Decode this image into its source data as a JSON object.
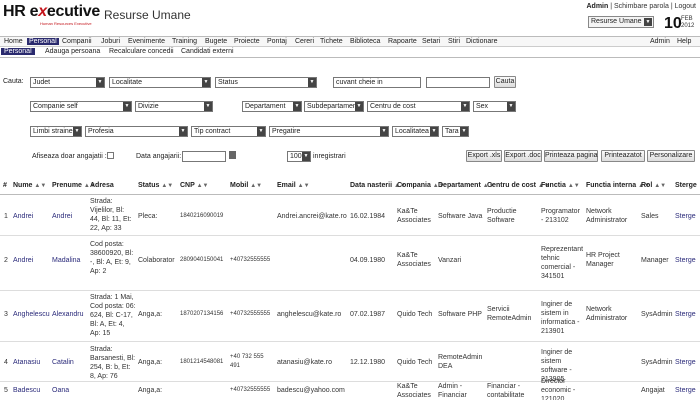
{
  "header": {
    "logo_main": "HR e",
    "logo_x": "x",
    "logo_rest": "ecutive",
    "logo_sub": "Human Resources Executive",
    "app_title": "Resurse Umane",
    "user": "Admin",
    "link_password": "Schimbare parola",
    "link_logout": "Logout",
    "module_select": "Resurse Umane",
    "date_day": "10",
    "date_month": "FEB",
    "date_year": "2012"
  },
  "menu": {
    "items": [
      "Home",
      "Personal",
      "Companii",
      "Joburi",
      "Evenimente",
      "Training",
      "Bugete",
      "Proiecte",
      "Pontaj",
      "Cereri",
      "Tichete",
      "Biblioteca",
      "Rapoarte",
      "Setari",
      "Stiri",
      "Dictionare"
    ],
    "admin": "Admin",
    "help": "Help"
  },
  "submenu": {
    "items": [
      "Personal",
      "Adauga persoana",
      "Recalculare concedii",
      "Candidati externi"
    ]
  },
  "filters": {
    "cauta_label": "Cauta:",
    "judet": "Judet",
    "localitate": "Localitate",
    "status": "Status",
    "keyword_placeholder": "cuvant cheie in",
    "cauta_button": "Cauta",
    "companie": "Companie self",
    "divizie": "Divizie",
    "departament": "Departament",
    "subdepartament": "Subdepartament",
    "centru_cost": "Centru de cost",
    "sex": "Sex",
    "limbi_straine": "Limbi straine",
    "profesia": "Profesia",
    "tip_contract": "Tip contract",
    "pregatire": "Pregatire",
    "localitatea": "Localitatea",
    "tara": "Tara",
    "only_employees_label": "Afiseaza doar angajatii :",
    "hire_date_label": "Data angajarii:",
    "per_page": "100",
    "per_page_suffix": "inregistrari",
    "btn_export_xls": "Export .xls",
    "btn_export_doc": "Export .doc",
    "btn_print_page": "Printeaza pagina",
    "btn_print_all": "Printeazatot",
    "btn_personalize": "Personalizare"
  },
  "table": {
    "columns": [
      "#",
      "Nume",
      "Prenume",
      "Adresa",
      "Status",
      "CNP",
      "Mobil",
      "Email",
      "Data nasterii",
      "Compania",
      "Departament",
      "Centru de cost",
      "Functia",
      "Functia interna",
      "Rol",
      "Sterge"
    ],
    "rows": [
      {
        "num": "1",
        "nume": "Andrei",
        "prenume": "Andrei",
        "adresa": "Strada: Vijelilor, Bl: 44, Bl: 11, Et: 22, Ap: 33",
        "status": "Pleca:",
        "cnp": "1840216090019",
        "mobil": "",
        "email": "Andrei.ancrei@kate.ro",
        "data": "16.02.1984",
        "compania": "Ka&Te Associates",
        "departament": "Software Java",
        "centru": "Productie Software",
        "functia": "Programator - 213102",
        "functia_interna": "Network Administrator",
        "rol": "Sales",
        "sterge": "Sterge"
      },
      {
        "num": "2",
        "nume": "Andrei",
        "prenume": "Madalina",
        "adresa": "Cod posta: 38600920, Bl: -, Bl: A, Et: 9, Ap: 2",
        "status": "Colaborator",
        "cnp": "2809040150041",
        "mobil": "+40732555555",
        "email": "",
        "data": "04.09.1980",
        "compania": "Ka&Te Associates",
        "departament": "Vanzari",
        "centru": "",
        "functia": "Reprezentant tehnic comercial - 341501",
        "functia_interna": "HR Project Manager",
        "rol": "Manager",
        "sterge": "Sterge"
      },
      {
        "num": "3",
        "nume": "Anghelescu",
        "prenume": "Alexandru",
        "adresa": "Strada: 1 Mai, Cod posta: 06: 624, Bl: C-17, Bl: A, Et: 4, Ap: 15",
        "status": "Anga,a:",
        "cnp": "1870207134156",
        "mobil": "+40732555555",
        "email": "anghelescu@kate.ro",
        "data": "07.02.1987",
        "compania": "Quido Tech",
        "departament": "Software PHP",
        "centru": "Servicii RemoteAdmin",
        "functia": "Inginer de sistem in informatica - 213901",
        "functia_interna": "Network Administrator",
        "rol": "SysAdmin",
        "sterge": "Sterge"
      },
      {
        "num": "4",
        "nume": "Atanasiu",
        "prenume": "Catalin",
        "adresa": "Strada: Barsanesti, Bl: 254, B: b, Et: 8, Ap: 76",
        "status": "Anga,a:",
        "cnp": "1801214548081",
        "mobil": "+40 732 555 491",
        "email": "atanasiu@kate.ro",
        "data": "12.12.1980",
        "compania": "Quido Tech",
        "departament": "RemoteAdmin DEA",
        "centru": "",
        "functia": "Inginer de sistem software - 213905",
        "functia_interna": "",
        "rol": "SysAdmin",
        "sterge": "Sterge"
      },
      {
        "num": "5",
        "nume": "Badescu",
        "prenume": "Oana",
        "adresa": "",
        "status": "Anga,a:",
        "cnp": "",
        "mobil": "+40732555555",
        "email": "badescu@yahoo.com",
        "data": "",
        "compania": "Ka&Te Associates",
        "departament": "Admin - Financiar",
        "centru": "Financiar - contabilitate",
        "functia": "Director economic - 121020",
        "functia_interna": "",
        "rol": "Angajat",
        "sterge": "Sterge"
      }
    ]
  }
}
